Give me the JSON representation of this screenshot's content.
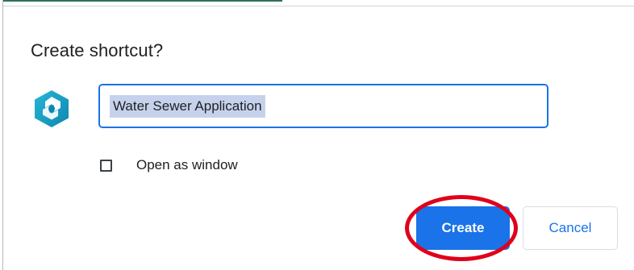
{
  "dialog": {
    "title": "Create shortcut?",
    "app_icon": "teal-hexagon-app-icon",
    "name_input": {
      "value": "Water Sewer Application",
      "selected": true
    },
    "open_as_window": {
      "label": "Open as window",
      "checked": false
    },
    "buttons": {
      "create_label": "Create",
      "cancel_label": "Cancel"
    }
  },
  "colors": {
    "accent": "#1a73e8",
    "selection": "#c6d2ec",
    "icon_teal": "#1aa3c8",
    "annotation_ring": "#e0001a"
  }
}
